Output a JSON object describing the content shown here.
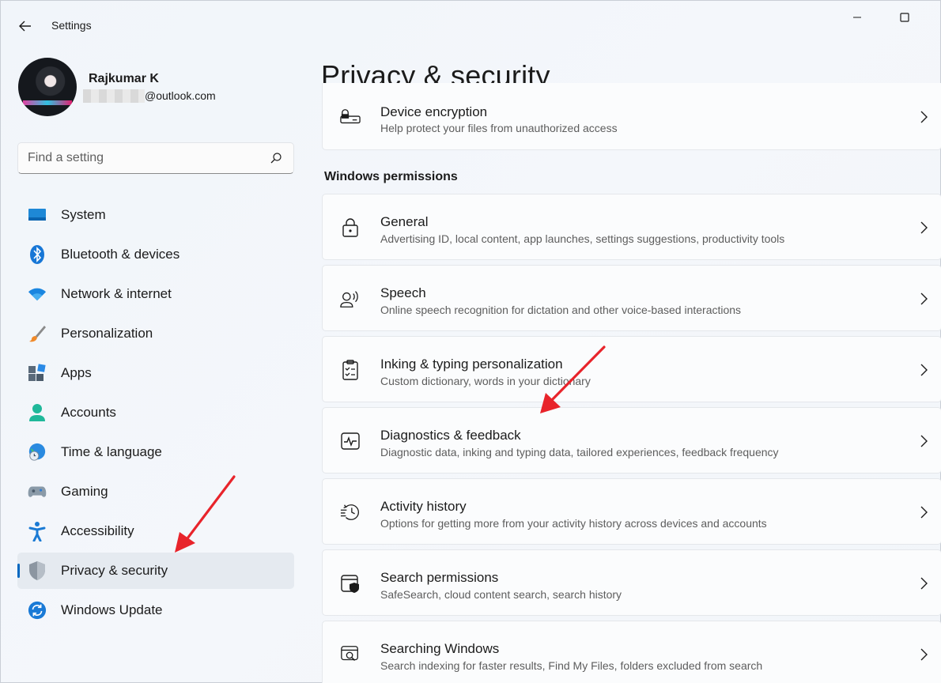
{
  "window": {
    "title": "Settings"
  },
  "profile": {
    "name": "Rajkumar K",
    "email_suffix": "@outlook.com"
  },
  "search": {
    "placeholder": "Find a setting"
  },
  "sidebar": {
    "items": [
      {
        "label": "System",
        "icon": "system-icon"
      },
      {
        "label": "Bluetooth & devices",
        "icon": "bluetooth-icon"
      },
      {
        "label": "Network & internet",
        "icon": "wifi-icon"
      },
      {
        "label": "Personalization",
        "icon": "brush-icon"
      },
      {
        "label": "Apps",
        "icon": "apps-icon"
      },
      {
        "label": "Accounts",
        "icon": "accounts-icon"
      },
      {
        "label": "Time & language",
        "icon": "globe-clock-icon"
      },
      {
        "label": "Gaming",
        "icon": "gamepad-icon"
      },
      {
        "label": "Accessibility",
        "icon": "accessibility-icon"
      },
      {
        "label": "Privacy & security",
        "icon": "shield-icon",
        "selected": true
      },
      {
        "label": "Windows Update",
        "icon": "update-icon"
      }
    ]
  },
  "main": {
    "title": "Privacy & security",
    "top_card": {
      "title": "Device encryption",
      "desc": "Help protect your files from unauthorized access",
      "icon": "encryption-icon"
    },
    "section_label": "Windows permissions",
    "cards": [
      {
        "title": "General",
        "desc": "Advertising ID, local content, app launches, settings suggestions, productivity tools",
        "icon": "lock-icon"
      },
      {
        "title": "Speech",
        "desc": "Online speech recognition for dictation and other voice-based interactions",
        "icon": "speech-icon"
      },
      {
        "title": "Inking & typing personalization",
        "desc": "Custom dictionary, words in your dictionary",
        "icon": "clipboard-icon"
      },
      {
        "title": "Diagnostics & feedback",
        "desc": "Diagnostic data, inking and typing data, tailored experiences, feedback frequency",
        "icon": "pulse-icon"
      },
      {
        "title": "Activity history",
        "desc": "Options for getting more from your activity history across devices and accounts",
        "icon": "history-icon"
      },
      {
        "title": "Search permissions",
        "desc": "SafeSearch, cloud content search, search history",
        "icon": "search-shield-icon"
      },
      {
        "title": "Searching Windows",
        "desc": "Search indexing for faster results, Find My Files, folders excluded from search",
        "icon": "search-window-icon"
      }
    ]
  },
  "colors": {
    "accent": "#0067c0",
    "annotation_arrow": "#e8242b"
  }
}
